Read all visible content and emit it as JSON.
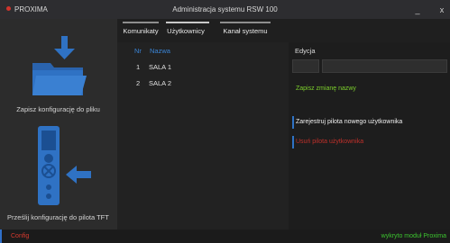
{
  "window": {
    "app_name": "PROXIMA",
    "title": "Administracja systemu RSW 100",
    "minimize": "_",
    "close": "x"
  },
  "sidebar": {
    "save_label": "Zapisz konfigurację do pliku",
    "send_label": "Prześlij konfigurację do pilota TFT"
  },
  "tabs": [
    {
      "label": "Komunikaty"
    },
    {
      "label": "Użytkownicy"
    },
    {
      "label": "Kanał systemu"
    }
  ],
  "list": {
    "headers": {
      "nr": "Nr",
      "name": "Nazwa"
    },
    "rows": [
      {
        "nr": "1",
        "name": "SALA 1"
      },
      {
        "nr": "2",
        "name": "SALA 2"
      }
    ]
  },
  "edit": {
    "title": "Edycja",
    "id_value": "",
    "name_value": "",
    "save_name": "Zapisz zmianę nazwy",
    "register_remote": "Zarejestruj pilota nowego użytkownika",
    "remove_user": "Usuń pilota użytkownika"
  },
  "status": {
    "left": "Config",
    "right": "wykryto moduł Proxima"
  },
  "colors": {
    "accent_blue": "#3a84d6",
    "action_green": "#7ccf2c",
    "action_red": "#c0302a",
    "status_green": "#3cc42f",
    "status_red": "#d83a2e"
  }
}
